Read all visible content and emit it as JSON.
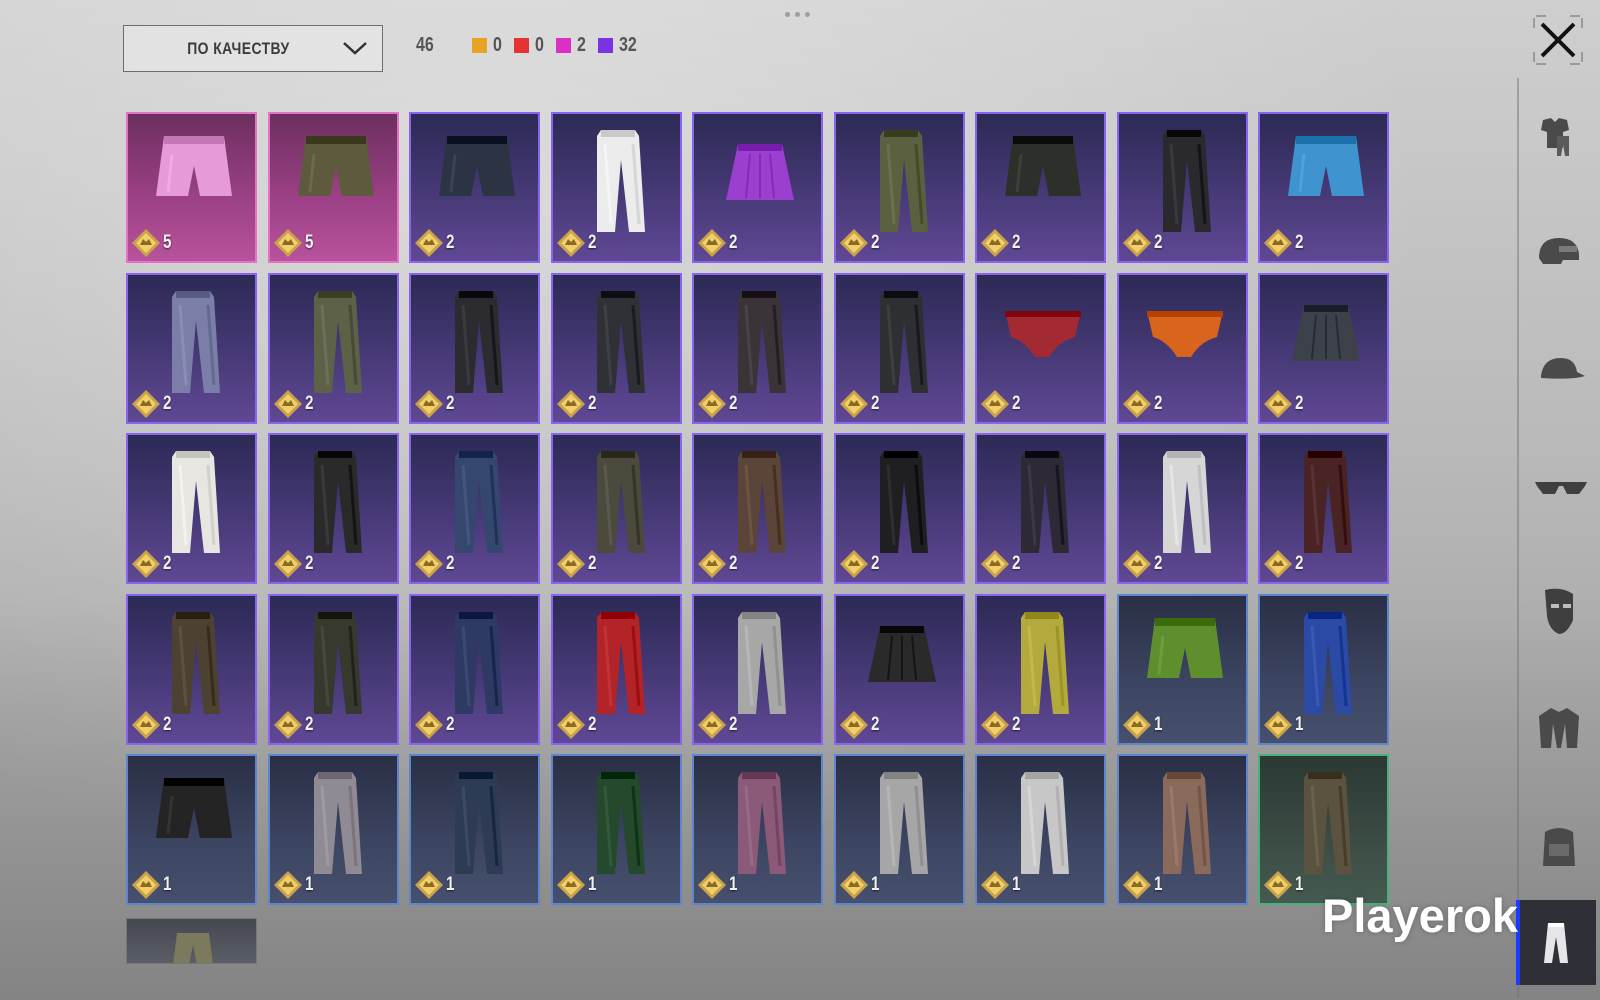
{
  "sort_select": {
    "label": "ПО КАЧЕСТВУ"
  },
  "stats": {
    "total": "46",
    "rarity_counts": [
      {
        "name": "orange",
        "color": "#e8a224",
        "count": "0"
      },
      {
        "name": "red",
        "color": "#e53232",
        "count": "0"
      },
      {
        "name": "pink",
        "color": "#db2fc6",
        "count": "2"
      },
      {
        "name": "purple",
        "color": "#7a32e2",
        "count": "32"
      }
    ]
  },
  "categories": [
    {
      "icon": "outfit-icon",
      "active": false
    },
    {
      "icon": "helmet-icon",
      "active": false
    },
    {
      "icon": "cap-icon",
      "active": false
    },
    {
      "icon": "glasses-icon",
      "active": false
    },
    {
      "icon": "mask-icon",
      "active": false
    },
    {
      "icon": "jacket-icon",
      "active": false
    },
    {
      "icon": "backpack-icon",
      "active": false
    },
    {
      "icon": "pants-icon",
      "active": true
    }
  ],
  "quality_colors": {
    "pink": "#e572c6",
    "purple": "#8a63f2",
    "blue": "#5d86ce",
    "green": "#49b27a"
  },
  "items": [
    {
      "quality": "pink",
      "count": "5",
      "type": "shorts",
      "color": "#e69ad8"
    },
    {
      "quality": "pink",
      "count": "5",
      "type": "shorts",
      "color": "#5e5a3e"
    },
    {
      "quality": "purple",
      "count": "2",
      "type": "shorts",
      "color": "#2c3444"
    },
    {
      "quality": "purple",
      "count": "2",
      "type": "pants",
      "color": "#ececec"
    },
    {
      "quality": "purple",
      "count": "2",
      "type": "skirt",
      "color": "#9a3fd0"
    },
    {
      "quality": "purple",
      "count": "2",
      "type": "pants",
      "color": "#5b6140"
    },
    {
      "quality": "purple",
      "count": "2",
      "type": "shorts",
      "color": "#2c2f2a"
    },
    {
      "quality": "purple",
      "count": "2",
      "type": "pants",
      "color": "#2a2a2e"
    },
    {
      "quality": "purple",
      "count": "2",
      "type": "shorts",
      "color": "#3f93cf"
    },
    {
      "quality": "purple",
      "count": "2",
      "type": "pants",
      "color": "#7b7fa8"
    },
    {
      "quality": "purple",
      "count": "2",
      "type": "pants",
      "color": "#5d6148"
    },
    {
      "quality": "purple",
      "count": "2",
      "type": "pants",
      "color": "#2b2b30"
    },
    {
      "quality": "purple",
      "count": "2",
      "type": "pants",
      "color": "#303037"
    },
    {
      "quality": "purple",
      "count": "2",
      "type": "pants",
      "color": "#3a3439"
    },
    {
      "quality": "purple",
      "count": "2",
      "type": "pants",
      "color": "#2e2f33"
    },
    {
      "quality": "purple",
      "count": "2",
      "type": "briefs",
      "color": "#a42a32"
    },
    {
      "quality": "purple",
      "count": "2",
      "type": "briefs",
      "color": "#d8641e"
    },
    {
      "quality": "purple",
      "count": "2",
      "type": "skirt",
      "color": "#3d414a"
    },
    {
      "quality": "purple",
      "count": "2",
      "type": "pants",
      "color": "#e8e6e0"
    },
    {
      "quality": "purple",
      "count": "2",
      "type": "pants",
      "color": "#2a2a2a"
    },
    {
      "quality": "purple",
      "count": "2",
      "type": "pants",
      "color": "#35476e"
    },
    {
      "quality": "purple",
      "count": "2",
      "type": "pants",
      "color": "#4c4a3c"
    },
    {
      "quality": "purple",
      "count": "2",
      "type": "pants",
      "color": "#5a4538"
    },
    {
      "quality": "purple",
      "count": "2",
      "type": "pants",
      "color": "#1f1f22"
    },
    {
      "quality": "purple",
      "count": "2",
      "type": "pants",
      "color": "#2d2a35"
    },
    {
      "quality": "purple",
      "count": "2",
      "type": "pants",
      "color": "#d6d6d6"
    },
    {
      "quality": "purple",
      "count": "2",
      "type": "pants",
      "color": "#4a2424"
    },
    {
      "quality": "purple",
      "count": "2",
      "type": "pants",
      "color": "#4d4231"
    },
    {
      "quality": "purple",
      "count": "2",
      "type": "pants",
      "color": "#37392e"
    },
    {
      "quality": "purple",
      "count": "2",
      "type": "pants",
      "color": "#2e3a63"
    },
    {
      "quality": "purple",
      "count": "2",
      "type": "pants",
      "color": "#b32428"
    },
    {
      "quality": "purple",
      "count": "2",
      "type": "pants",
      "color": "#a7a7a7"
    },
    {
      "quality": "purple",
      "count": "2",
      "type": "skirt",
      "color": "#2a2a2a"
    },
    {
      "quality": "purple",
      "count": "2",
      "type": "pants",
      "color": "#b3a93c"
    },
    {
      "quality": "blue",
      "count": "1",
      "type": "shorts",
      "color": "#5e8e2e"
    },
    {
      "quality": "blue",
      "count": "1",
      "type": "pants",
      "color": "#2b4aa6"
    },
    {
      "quality": "blue",
      "count": "1",
      "type": "shorts",
      "color": "#242424"
    },
    {
      "quality": "blue",
      "count": "1",
      "type": "pants",
      "color": "#8f8a93"
    },
    {
      "quality": "blue",
      "count": "1",
      "type": "pants",
      "color": "#2e3b55"
    },
    {
      "quality": "blue",
      "count": "1",
      "type": "pants",
      "color": "#24492c"
    },
    {
      "quality": "blue",
      "count": "1",
      "type": "pants",
      "color": "#8a5a78"
    },
    {
      "quality": "blue",
      "count": "1",
      "type": "pants",
      "color": "#a6a6a6"
    },
    {
      "quality": "blue",
      "count": "1",
      "type": "pants",
      "color": "#c7c7c7"
    },
    {
      "quality": "blue",
      "count": "1",
      "type": "pants",
      "color": "#8a6a5a"
    },
    {
      "quality": "green",
      "count": "1",
      "type": "pants",
      "color": "#5b5240"
    }
  ],
  "partial_item": {
    "color": "#7b7a5c"
  },
  "watermark": "Playerok"
}
